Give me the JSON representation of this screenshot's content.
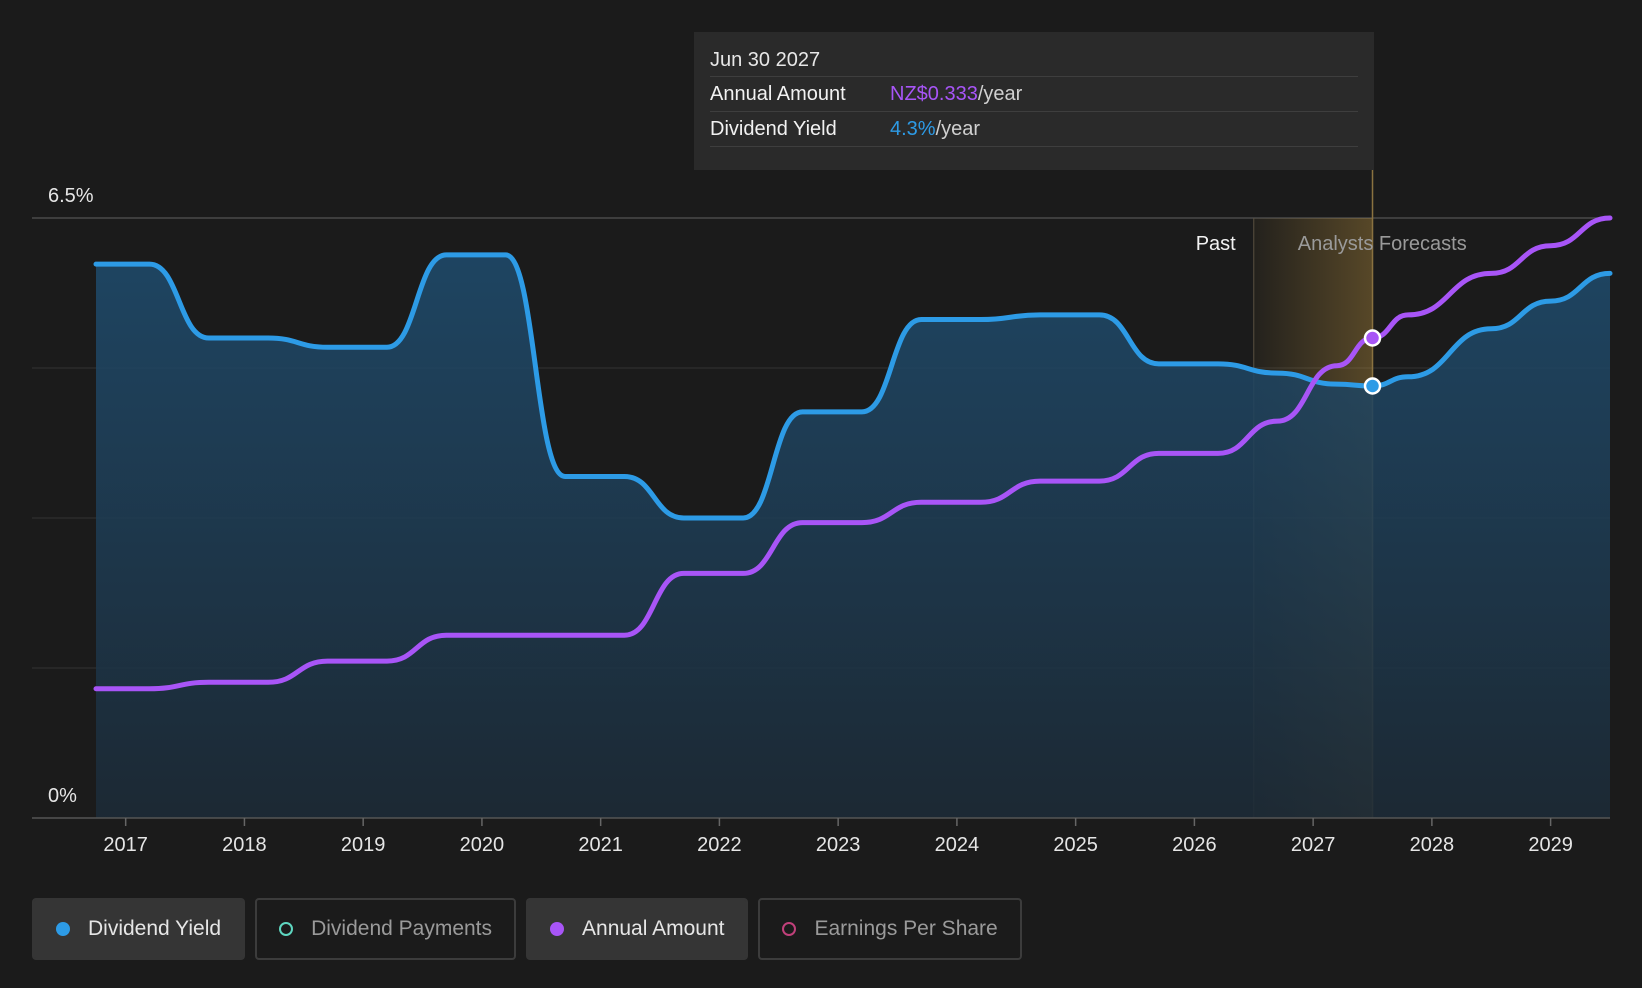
{
  "tooltip": {
    "date": "Jun 30 2027",
    "rows": [
      {
        "label": "Annual Amount",
        "value": "NZ$0.333",
        "unit": "/year"
      },
      {
        "label": "Dividend Yield",
        "value": "4.3%",
        "unit": "/year"
      }
    ]
  },
  "legend": [
    {
      "label": "Dividend Yield",
      "active": true,
      "color": "#2d9be6"
    },
    {
      "label": "Dividend Payments",
      "active": false,
      "color": "#5ed6c0"
    },
    {
      "label": "Annual Amount",
      "active": true,
      "color": "#a855f7"
    },
    {
      "label": "Earnings Per Share",
      "active": false,
      "color": "#c0407a"
    }
  ],
  "colors": {
    "yield": "#2d9be6",
    "amount": "#a855f7",
    "forecast_band": "#c79a3f",
    "background": "#1b1b1b"
  },
  "chart_data": {
    "type": "line",
    "y_axis_labels": [
      "6.5%",
      "0%"
    ],
    "ylim": [
      0,
      6.5
    ],
    "xlim": [
      2016.75,
      2029.5
    ],
    "x_ticks": [
      "2017",
      "2018",
      "2019",
      "2020",
      "2021",
      "2022",
      "2023",
      "2024",
      "2025",
      "2026",
      "2027",
      "2028",
      "2029"
    ],
    "regions": {
      "past_label": "Past",
      "forecast_label": "Analysts Forecasts",
      "forecast_start": 2026.5,
      "hover_x": 2027.5
    },
    "series": [
      {
        "name": "Dividend Yield",
        "color": "#2d9be6",
        "area": true,
        "x": [
          2016.75,
          2017.2,
          2017.7,
          2018.2,
          2018.7,
          2019.2,
          2019.7,
          2020.2,
          2020.7,
          2021.2,
          2021.7,
          2022.2,
          2022.7,
          2023.2,
          2023.7,
          2024.2,
          2024.7,
          2025.2,
          2025.7,
          2026.2,
          2026.7,
          2027.2,
          2027.5,
          2027.8,
          2028.5,
          2029.0,
          2029.5
        ],
        "values": [
          6.0,
          6.0,
          5.2,
          5.2,
          5.1,
          5.1,
          6.1,
          6.1,
          3.7,
          3.7,
          3.25,
          3.25,
          4.4,
          4.4,
          5.4,
          5.4,
          5.45,
          5.45,
          4.92,
          4.92,
          4.82,
          4.7,
          4.68,
          4.78,
          5.3,
          5.6,
          5.9
        ]
      },
      {
        "name": "Annual Amount",
        "color": "#a855f7",
        "area": false,
        "x": [
          2016.75,
          2017.2,
          2017.7,
          2018.2,
          2018.7,
          2019.2,
          2019.7,
          2020.2,
          2020.7,
          2021.2,
          2021.7,
          2022.2,
          2022.7,
          2023.2,
          2023.7,
          2024.2,
          2024.7,
          2025.2,
          2025.7,
          2026.2,
          2026.7,
          2027.2,
          2027.5,
          2027.8,
          2028.5,
          2029.0,
          2029.5
        ],
        "values": [
          1.4,
          1.4,
          1.47,
          1.47,
          1.7,
          1.7,
          1.98,
          1.98,
          1.98,
          1.98,
          2.65,
          2.65,
          3.2,
          3.2,
          3.42,
          3.42,
          3.65,
          3.65,
          3.95,
          3.95,
          4.3,
          4.9,
          5.2,
          5.45,
          5.9,
          6.2,
          6.5
        ]
      }
    ]
  }
}
